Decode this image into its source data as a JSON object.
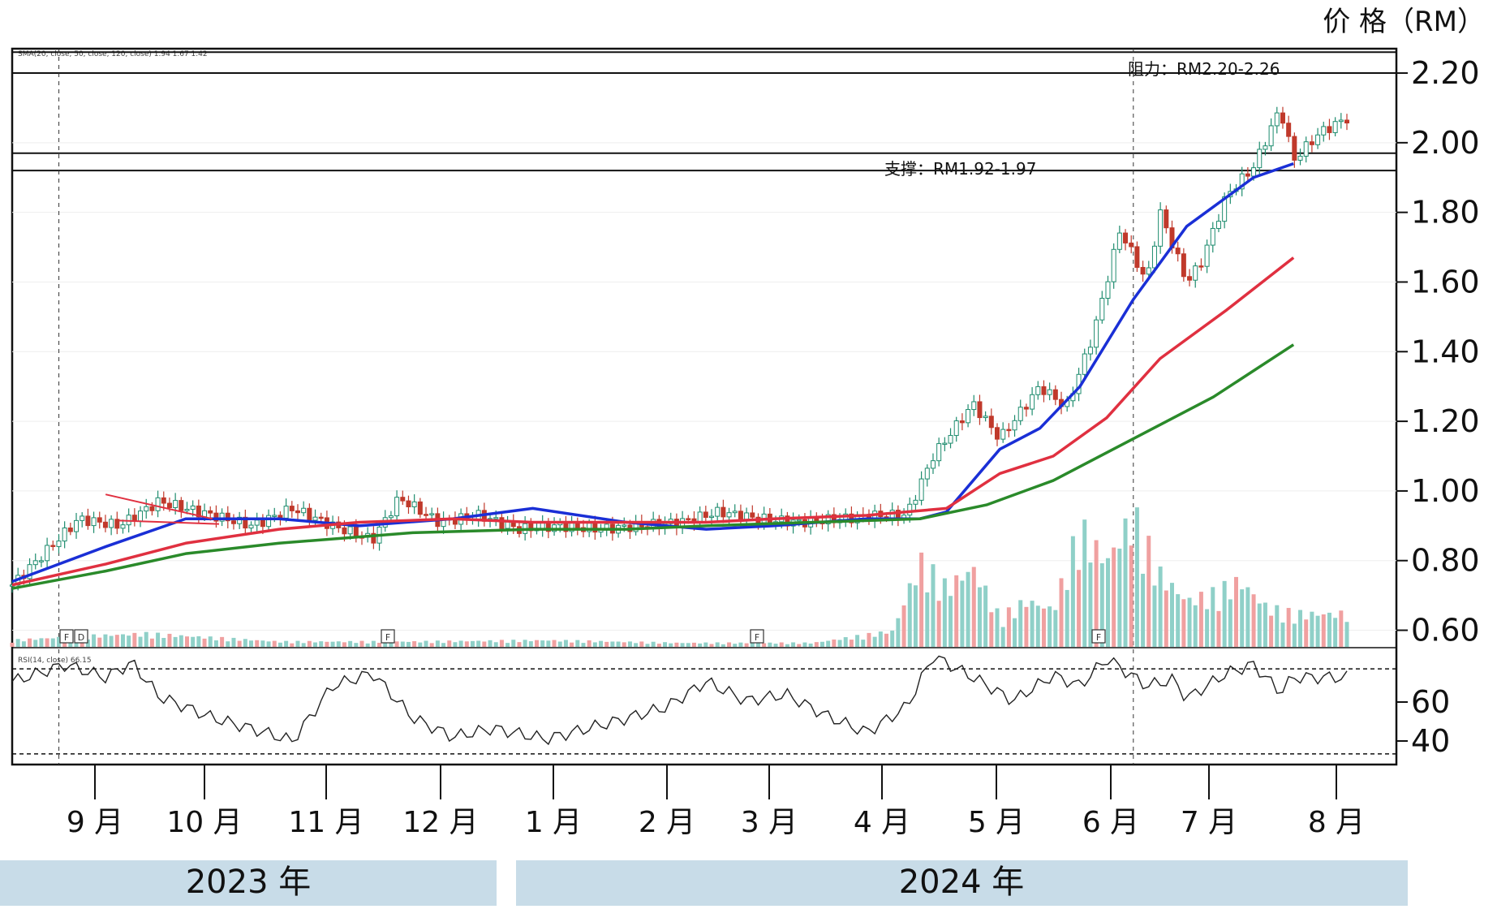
{
  "chart_data": {
    "type": "candlestick",
    "y_unit_label": "价 格（RM）",
    "ylim": [
      0.55,
      2.27
    ],
    "yticks": [
      "2.20",
      "2.00",
      "1.80",
      "1.60",
      "1.40",
      "1.20",
      "1.00",
      "0.80",
      "0.60"
    ],
    "ytick_values": [
      2.2,
      2.0,
      1.8,
      1.6,
      1.4,
      1.2,
      1.0,
      0.8,
      0.6
    ],
    "rsi_ticks": [
      "60",
      "40"
    ],
    "rsi_tick_values": [
      60,
      40
    ],
    "rsi_levels": [
      70,
      30
    ],
    "months": [
      "9 月",
      "10 月",
      "11 月",
      "12 月",
      "1 月",
      "2 月",
      "3 月",
      "4 月",
      "5 月",
      "6 月",
      "7 月",
      "8 月"
    ],
    "years": [
      "2023 年",
      "2024 年"
    ],
    "annotations": {
      "resistance": "阻力：RM2.20-2.26",
      "support": "支撑：RM1.92-1.97"
    },
    "resistance_band": [
      2.2,
      2.26
    ],
    "support_band": [
      1.92,
      1.97
    ],
    "header_lines": [
      "SMA(20, close, 50, close, 120, close) 1.94 1.67 1.42",
      "RSI(14, close) 66.15"
    ],
    "event_markers": [
      {
        "label": "F",
        "month_index": 0
      },
      {
        "label": "D",
        "month_index": 0
      },
      {
        "label": "F",
        "month_index": 3
      },
      {
        "label": "F",
        "month_index": 6
      },
      {
        "label": "F",
        "month_index": 9
      }
    ],
    "price_path": [
      [
        0.73,
        0.0
      ],
      [
        0.92,
        0.05
      ],
      [
        0.9,
        0.08
      ],
      [
        0.97,
        0.11
      ],
      [
        0.93,
        0.15
      ],
      [
        0.9,
        0.18
      ],
      [
        0.95,
        0.21
      ],
      [
        0.9,
        0.24
      ],
      [
        0.86,
        0.27
      ],
      [
        0.98,
        0.29
      ],
      [
        0.91,
        0.32
      ],
      [
        0.93,
        0.35
      ],
      [
        0.89,
        0.38
      ],
      [
        0.9,
        0.41
      ],
      [
        0.89,
        0.44
      ],
      [
        0.9,
        0.47
      ],
      [
        0.91,
        0.5
      ],
      [
        0.94,
        0.53
      ],
      [
        0.92,
        0.56
      ],
      [
        0.91,
        0.59
      ],
      [
        0.92,
        0.62
      ],
      [
        0.93,
        0.65
      ],
      [
        0.93,
        0.67
      ],
      [
        1.1,
        0.69
      ],
      [
        1.25,
        0.72
      ],
      [
        1.15,
        0.74
      ],
      [
        1.3,
        0.77
      ],
      [
        1.24,
        0.79
      ],
      [
        1.45,
        0.81
      ],
      [
        1.75,
        0.83
      ],
      [
        1.6,
        0.85
      ],
      [
        1.8,
        0.86
      ],
      [
        1.6,
        0.88
      ],
      [
        1.65,
        0.89
      ],
      [
        1.85,
        0.91
      ],
      [
        1.93,
        0.93
      ],
      [
        2.1,
        0.95
      ],
      [
        1.95,
        0.96
      ],
      [
        2.03,
        0.98
      ],
      [
        2.07,
        1.0
      ]
    ],
    "series": [
      {
        "name": "SMA 20",
        "color": "#1a2fd6",
        "values": [
          0.74,
          0.84,
          0.92,
          0.92,
          0.9,
          0.92,
          0.95,
          0.91,
          0.89,
          0.9,
          0.92,
          0.92,
          0.94,
          1.12,
          1.18,
          1.3,
          1.55,
          1.76,
          1.9,
          1.94
        ],
        "x": [
          0.0,
          0.07,
          0.13,
          0.2,
          0.26,
          0.33,
          0.39,
          0.46,
          0.52,
          0.57,
          0.64,
          0.68,
          0.7,
          0.74,
          0.77,
          0.8,
          0.84,
          0.88,
          0.93,
          0.96
        ]
      },
      {
        "name": "SMA 50",
        "color": "#e03040",
        "values": [
          0.73,
          0.79,
          0.85,
          0.89,
          0.91,
          0.92,
          0.91,
          0.91,
          0.91,
          0.92,
          0.93,
          0.95,
          1.05,
          1.1,
          1.21,
          1.38,
          1.52,
          1.67
        ],
        "x": [
          0.0,
          0.07,
          0.13,
          0.2,
          0.26,
          0.33,
          0.39,
          0.46,
          0.52,
          0.57,
          0.64,
          0.7,
          0.74,
          0.78,
          0.82,
          0.86,
          0.91,
          0.96
        ]
      },
      {
        "name": "SMA 120",
        "color": "#2a8a2a",
        "values": [
          0.72,
          0.77,
          0.82,
          0.85,
          0.88,
          0.89,
          0.89,
          0.9,
          0.91,
          0.92,
          0.96,
          1.03,
          1.15,
          1.27,
          1.42
        ],
        "x": [
          0.0,
          0.07,
          0.13,
          0.2,
          0.3,
          0.39,
          0.46,
          0.52,
          0.6,
          0.68,
          0.73,
          0.78,
          0.84,
          0.9,
          0.96
        ]
      }
    ],
    "volume_profile": [
      [
        0.0,
        0.05
      ],
      [
        0.05,
        0.08
      ],
      [
        0.1,
        0.1
      ],
      [
        0.2,
        0.04
      ],
      [
        0.3,
        0.04
      ],
      [
        0.4,
        0.05
      ],
      [
        0.5,
        0.03
      ],
      [
        0.6,
        0.03
      ],
      [
        0.66,
        0.12
      ],
      [
        0.68,
        0.65
      ],
      [
        0.7,
        0.45
      ],
      [
        0.72,
        0.6
      ],
      [
        0.74,
        0.22
      ],
      [
        0.76,
        0.35
      ],
      [
        0.78,
        0.28
      ],
      [
        0.8,
        0.9
      ],
      [
        0.82,
        0.65
      ],
      [
        0.84,
        1.0
      ],
      [
        0.86,
        0.55
      ],
      [
        0.88,
        0.35
      ],
      [
        0.9,
        0.4
      ],
      [
        0.92,
        0.5
      ],
      [
        0.94,
        0.3
      ],
      [
        0.96,
        0.25
      ]
    ],
    "rsi_path": [
      [
        64,
        0.0
      ],
      [
        72,
        0.04
      ],
      [
        66,
        0.07
      ],
      [
        73,
        0.09
      ],
      [
        57,
        0.11
      ],
      [
        52,
        0.13
      ],
      [
        47,
        0.15
      ],
      [
        40,
        0.19
      ],
      [
        36,
        0.21
      ],
      [
        62,
        0.24
      ],
      [
        68,
        0.27
      ],
      [
        47,
        0.3
      ],
      [
        38,
        0.33
      ],
      [
        42,
        0.36
      ],
      [
        37,
        0.4
      ],
      [
        45,
        0.45
      ],
      [
        52,
        0.49
      ],
      [
        64,
        0.52
      ],
      [
        55,
        0.55
      ],
      [
        58,
        0.58
      ],
      [
        48,
        0.61
      ],
      [
        40,
        0.64
      ],
      [
        52,
        0.67
      ],
      [
        76,
        0.69
      ],
      [
        66,
        0.72
      ],
      [
        55,
        0.75
      ],
      [
        67,
        0.78
      ],
      [
        62,
        0.8
      ],
      [
        75,
        0.82
      ],
      [
        62,
        0.85
      ],
      [
        65,
        0.87
      ],
      [
        56,
        0.88
      ],
      [
        68,
        0.91
      ],
      [
        72,
        0.93
      ],
      [
        59,
        0.95
      ],
      [
        66,
        0.96
      ]
    ],
    "grid": true,
    "legend": "top-left"
  }
}
